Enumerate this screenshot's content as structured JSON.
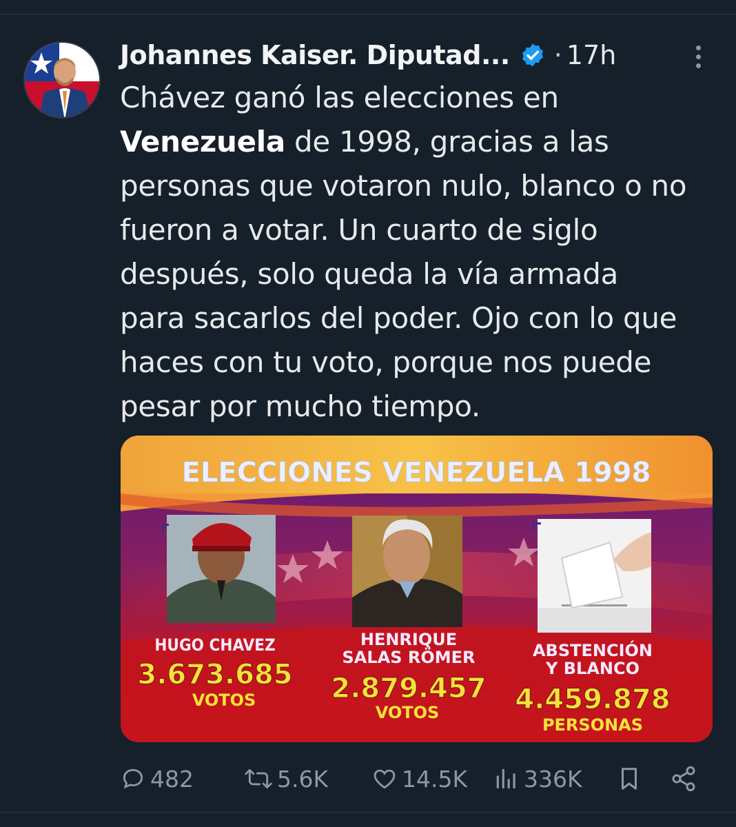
{
  "tweet": {
    "author_name": "Johannes Kaiser. Diputad...",
    "verified_icon": "verified-badge-icon",
    "separator": "·",
    "time": "17h",
    "text_lines": [
      [
        "",
        "Chávez ganó las elecciones en"
      ],
      [
        "Venezuela",
        " de 1998, gracias a las"
      ],
      [
        "",
        "personas que votaron nulo, blanco o no"
      ],
      [
        "",
        "fueron a votar. Un cuarto de siglo"
      ],
      [
        "",
        "después, solo queda la vía armada"
      ],
      [
        "",
        "para sacarlos del poder. Ojo con lo que"
      ],
      [
        "",
        "haces con tu voto, porque nos puede"
      ],
      [
        "",
        "pesar por mucho tiempo."
      ]
    ]
  },
  "media": {
    "title": "ELECCIONES VENEZUELA 1998",
    "candidates": [
      {
        "name_line1": "HUGO CHAVEZ",
        "name_line2": "",
        "value": "3.673.685",
        "unit": "VOTOS"
      },
      {
        "name_line1": "HENRIQUE",
        "name_line2": "SALAS RÖMER",
        "value": "2.879.457",
        "unit": "VOTOS"
      },
      {
        "name_line1": "ABSTENCIÓN",
        "name_line2": "Y BLANCO",
        "value": "4.459.878",
        "unit": "PERSONAS"
      }
    ]
  },
  "actions": {
    "replies": "482",
    "retweets": "5.6K",
    "likes": "14.5K",
    "views": "336K"
  },
  "colors": {
    "background": "#15202b",
    "verified": "#1d9bf0",
    "action_gray": "#8b98a5",
    "banner_yellow": "#f3e23a"
  }
}
